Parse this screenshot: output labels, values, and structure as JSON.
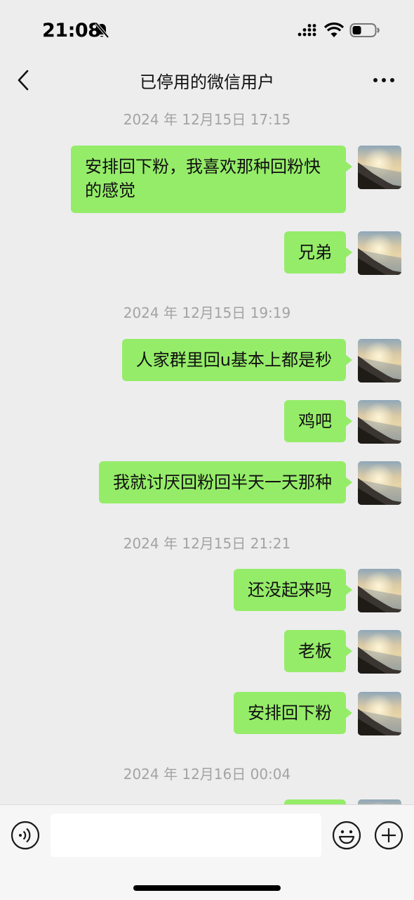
{
  "status_bar": {
    "time": "21:08",
    "icons": [
      "bell-slash-icon",
      "signal-icon",
      "wifi-icon",
      "battery-icon"
    ]
  },
  "nav": {
    "title": "已停用的微信用户",
    "back_icon": "chevron-left-icon",
    "more_icon": "more-dots-icon"
  },
  "colors": {
    "background": "#EDEDED",
    "bubble": "#95EC69",
    "timestamp": "#A3A3A3",
    "input_bar": "#F6F6F6"
  },
  "chat": {
    "timestamps": [
      "2024 年 12月15日 17:15",
      "2024 年 12月15日 19:19",
      "2024 年 12月15日 21:21",
      "2024 年 12月16日 00:04"
    ],
    "messages": [
      {
        "text": "安排回下粉，我喜欢那种回粉快的感觉",
        "sender": "me"
      },
      {
        "text": "兄弟",
        "sender": "me"
      },
      {
        "text": "人家群里回u基本上都是秒",
        "sender": "me"
      },
      {
        "text": "鸡吧",
        "sender": "me"
      },
      {
        "text": "我就讨厌回粉回半天一天那种",
        "sender": "me"
      },
      {
        "text": "还没起来吗",
        "sender": "me"
      },
      {
        "text": "老板",
        "sender": "me"
      },
      {
        "text": "安排回下粉",
        "sender": "me"
      },
      {
        "text": "",
        "sender": "me"
      }
    ]
  },
  "input_bar": {
    "voice_icon": "voice-icon",
    "input_value": "",
    "emoji_icon": "emoji-icon",
    "plus_icon": "plus-icon"
  }
}
